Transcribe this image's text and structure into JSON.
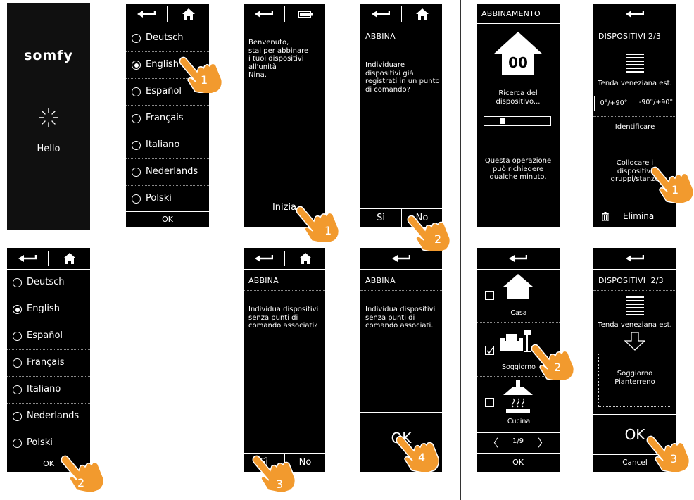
{
  "splash": {
    "logo": "somfy",
    "hello": "Hello"
  },
  "languages": [
    "Deutsch",
    "English",
    "Español",
    "Français",
    "Italiano",
    "Nederlands",
    "Polski"
  ],
  "lang_ok": "OK",
  "welcome": {
    "text": "Benvenuto,\nstai per abbinare\ni tuoi dispositivi\nall'unità\nNina.",
    "start": "Inizia"
  },
  "abbina1": {
    "title": "ABBINA",
    "text": "Individuare i\ndispositivi già\nregistrati in un punto\ndi comando?",
    "yes": "Sì",
    "no": "No"
  },
  "abbina2": {
    "title": "ABBINA",
    "text": "Individua dispositivi\nsenza punti di\ncomando associati?",
    "yes": "Sì",
    "no": "No"
  },
  "abbina3": {
    "title": "ABBINA",
    "text": "Individua dispositivi\nsenza punti di\ncomando associati.",
    "ok": "OK"
  },
  "pairing": {
    "title": "ABBINAMENTO",
    "count": "00",
    "search": "Ricerca del\ndispositivo...",
    "progress": 0.12,
    "note": "Questa operazione\npuò richiedere\nqualche minuto."
  },
  "devices": {
    "title": "DISPOSITIVI 2/3",
    "name": "Tenda veneziana est.",
    "angle1": "0°/+90°",
    "angle2": "-90°/+90°",
    "identify": "Identificare",
    "place": "Collocare i\ndispositivi\ngruppi/stanze",
    "delete": "Elimina"
  },
  "rooms": {
    "items": [
      {
        "label": "Casa",
        "checked": false
      },
      {
        "label": "Soggiorno",
        "checked": true
      },
      {
        "label": "Cucina",
        "checked": false
      }
    ],
    "page": "1/9",
    "ok": "OK"
  },
  "devices2": {
    "title": "DISPOSITIVI  2/3",
    "name": "Tenda veneziana est.",
    "room": "Soggiorno\nPianterreno",
    "ok": "OK",
    "cancel": "Cancel"
  },
  "steps": {
    "s1": "1",
    "s2": "2",
    "s3": "3",
    "s4": "4"
  },
  "colors": {
    "hand": "#f29a2e",
    "screen": "#000000",
    "divider": "#333333"
  }
}
